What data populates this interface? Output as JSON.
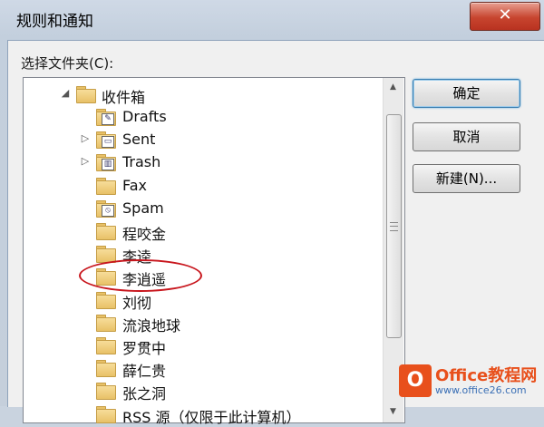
{
  "window": {
    "title": "规则和通知",
    "close_glyph": "✕"
  },
  "dialog": {
    "folder_label": "选择文件夹(C):",
    "buttons": {
      "ok": "确定",
      "cancel": "取消",
      "new": "新建(N)..."
    }
  },
  "tree": {
    "root": {
      "label": "收件箱",
      "expanded": true,
      "icon": "inbox-folder-icon"
    },
    "items": [
      {
        "label": "Drafts",
        "icon": "drafts-folder-icon",
        "arrow": ""
      },
      {
        "label": "Sent",
        "icon": "sent-folder-icon",
        "arrow": "▷"
      },
      {
        "label": "Trash",
        "icon": "trash-folder-icon",
        "arrow": "▷"
      },
      {
        "label": "Fax",
        "icon": "folder-icon",
        "arrow": ""
      },
      {
        "label": "Spam",
        "icon": "spam-folder-icon",
        "arrow": ""
      },
      {
        "label": "程咬金",
        "icon": "folder-icon",
        "arrow": ""
      },
      {
        "label": "李逵",
        "icon": "folder-icon",
        "arrow": ""
      },
      {
        "label": "李逍遥",
        "icon": "folder-icon",
        "arrow": ""
      },
      {
        "label": "刘彻",
        "icon": "folder-icon",
        "arrow": ""
      },
      {
        "label": "流浪地球",
        "icon": "folder-icon",
        "arrow": ""
      },
      {
        "label": "罗贯中",
        "icon": "folder-icon",
        "arrow": ""
      },
      {
        "label": "薛仁贵",
        "icon": "folder-icon",
        "arrow": ""
      },
      {
        "label": "张之洞",
        "icon": "folder-icon",
        "arrow": ""
      },
      {
        "label": "RSS 源（仅限于此计算机）",
        "icon": "folder-icon",
        "arrow": ""
      }
    ],
    "highlighted": "李逍遥"
  },
  "watermark": {
    "logo_letter": "O",
    "brand": "Office教程网",
    "url": "www.office26.com"
  },
  "colors": {
    "highlight": "#c8161d",
    "brand": "#e8501c"
  }
}
